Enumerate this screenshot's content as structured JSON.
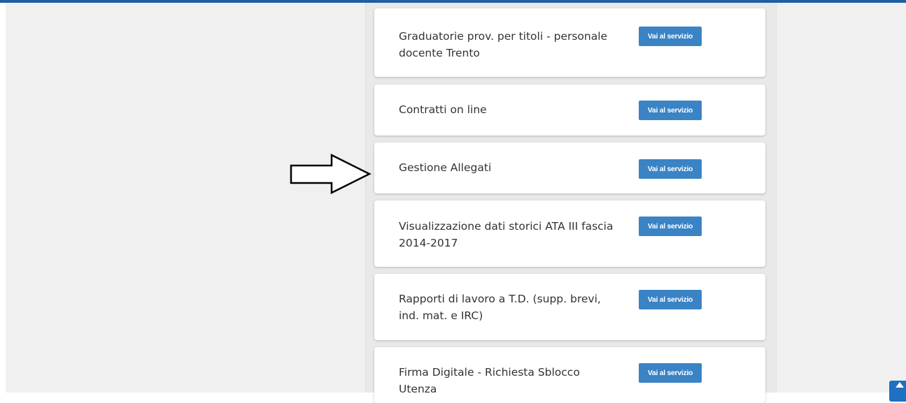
{
  "services": [
    {
      "title": "Graduatorie prov. per titoli - personale docente Trento",
      "button_label": "Vai al servizio"
    },
    {
      "title": "Contratti on line",
      "button_label": "Vai al servizio"
    },
    {
      "title": "Gestione Allegati",
      "button_label": "Vai al servizio"
    },
    {
      "title": "Visualizzazione dati storici ATA III fascia 2014-2017",
      "button_label": "Vai al servizio"
    },
    {
      "title": "Rapporti di lavoro a T.D. (supp. brevi, ind. mat. e IRC)",
      "button_label": "Vai al servizio"
    },
    {
      "title": "Firma Digitale - Richiesta Sblocco Utenza",
      "button_label": "Vai al servizio"
    }
  ],
  "icons": {
    "annotation": "arrow-right-icon",
    "scroll": "arrow-up-icon"
  },
  "colors": {
    "accent": "#1f5fa3",
    "button": "#3a83c5",
    "background": "#f0f0f0",
    "card": "#ffffff",
    "text": "#333333"
  }
}
